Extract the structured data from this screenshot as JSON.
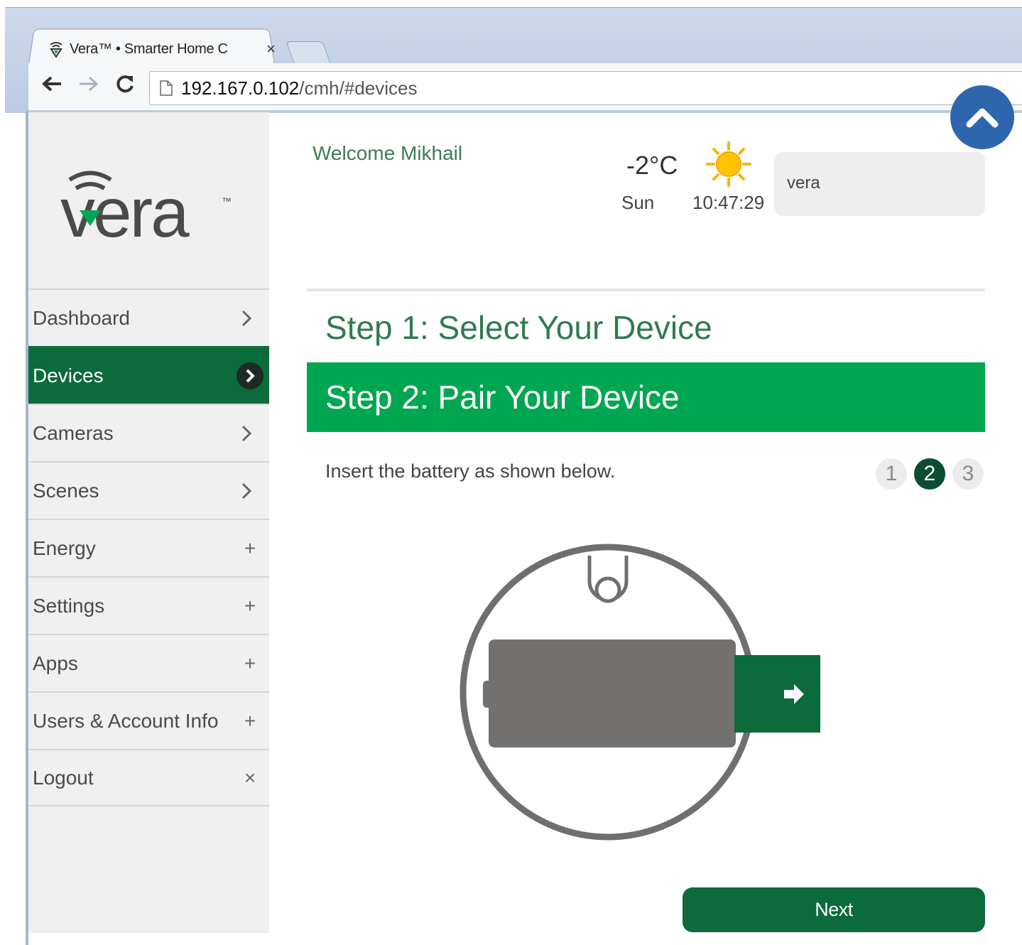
{
  "browser": {
    "tab_title": "Vera™ • Smarter Home C",
    "tab_close": "×",
    "url_host": "192.167.0.102",
    "url_path": "/cmh/#devices"
  },
  "sidebar": {
    "logo_text": "vera",
    "logo_tm": "™",
    "items": [
      {
        "label": "Dashboard",
        "icon": "chevron-right-icon",
        "active": false
      },
      {
        "label": "Devices",
        "icon": "chevron-right-icon",
        "active": true
      },
      {
        "label": "Cameras",
        "icon": "chevron-right-icon",
        "active": false
      },
      {
        "label": "Scenes",
        "icon": "chevron-right-icon",
        "active": false
      },
      {
        "label": "Energy",
        "icon": "plus-icon",
        "glyph": "+",
        "active": false
      },
      {
        "label": "Settings",
        "icon": "plus-icon",
        "glyph": "+",
        "active": false
      },
      {
        "label": "Apps",
        "icon": "plus-icon",
        "glyph": "+",
        "active": false
      },
      {
        "label": "Users & Account Info",
        "icon": "plus-icon",
        "glyph": "+",
        "active": false
      },
      {
        "label": "Logout",
        "icon": "close-icon",
        "glyph": "×",
        "active": false
      }
    ]
  },
  "header": {
    "welcome": "Welcome Mikhail",
    "temperature": "-2°C",
    "weather_icon": "sun-icon",
    "day": "Sun",
    "time": "10:47:29",
    "controller_name": "vera"
  },
  "wizard": {
    "step1_title": "Step 1: Select Your Device",
    "step2_title": "Step 2: Pair Your Device",
    "instruction": "Insert the battery as shown below.",
    "pages": [
      "1",
      "2",
      "3"
    ],
    "current_page": "2",
    "next_label": "Next"
  },
  "colors": {
    "brand_green": "#00a651",
    "dark_green": "#0b6b3b",
    "scroll_top_blue": "#2d66ad"
  }
}
